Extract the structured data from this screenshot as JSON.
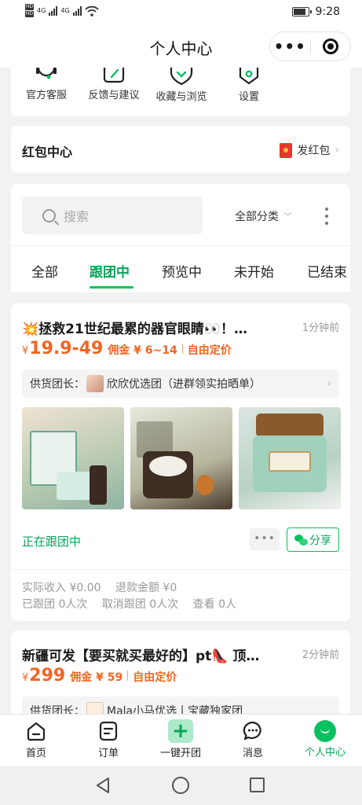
{
  "status_bar": {
    "sim1": "HD",
    "sim2": "HD",
    "net1": "4G",
    "net2": "4G",
    "time": "9:28"
  },
  "nav": {
    "title": "个人中心",
    "more_label": "•••"
  },
  "quick_actions": [
    {
      "label": "官方客服",
      "icon": "headset-icon"
    },
    {
      "label": "反馈与建议",
      "icon": "edit-icon"
    },
    {
      "label": "收藏与浏览",
      "icon": "shield-icon"
    },
    {
      "label": "设置",
      "icon": "settings-icon"
    }
  ],
  "red_packet": {
    "title": "红包中心",
    "send_label": "发红包",
    "chevron": "›"
  },
  "filter": {
    "search_placeholder": "搜索",
    "category": "全部分类",
    "category_arrow": "﹀",
    "tabs": [
      "全部",
      "跟团中",
      "预览中",
      "未开始",
      "已结束"
    ],
    "active_tab": "跟团中"
  },
  "products": [
    {
      "title": "💥拯救21世纪最累的器官眼睛👀！…",
      "time": "1分钟前",
      "currency": "¥",
      "price": "19.9-49",
      "commission": "佣金 ¥ 6~14",
      "pricing": "自由定价",
      "supplier_label": "供货团长：",
      "supplier_name": "欣欣优选团（进群领实拍晒单）",
      "status": "正在跟团中",
      "more": "•••",
      "share": "分享",
      "stats": {
        "income": "实际收入 ¥0.00",
        "refund": "退款金额 ¥0",
        "joined": "已跟团 0人次",
        "cancelled": "取消跟团 0人次",
        "views": "查看 0人"
      }
    },
    {
      "title": "新疆可发【要买就买最好的】pt👠 顶…",
      "time": "2分钟前",
      "currency": "¥",
      "price": "299",
      "commission": "佣金 ¥ 59",
      "pricing": "自由定价",
      "supplier_label": "供货团长：",
      "supplier_name": "Mala小马优选丨宝藏独家团"
    }
  ],
  "tab_bar": [
    {
      "label": "首页",
      "icon": "home-icon"
    },
    {
      "label": "订单",
      "icon": "order-icon"
    },
    {
      "label": "一键开团",
      "icon": "plus-icon"
    },
    {
      "label": "消息",
      "icon": "message-icon"
    },
    {
      "label": "个人中心",
      "icon": "profile-icon",
      "active": true
    }
  ],
  "colors": {
    "brand_green": "#07c160",
    "price_orange": "#f26522",
    "red_packet": "#e8362e"
  }
}
